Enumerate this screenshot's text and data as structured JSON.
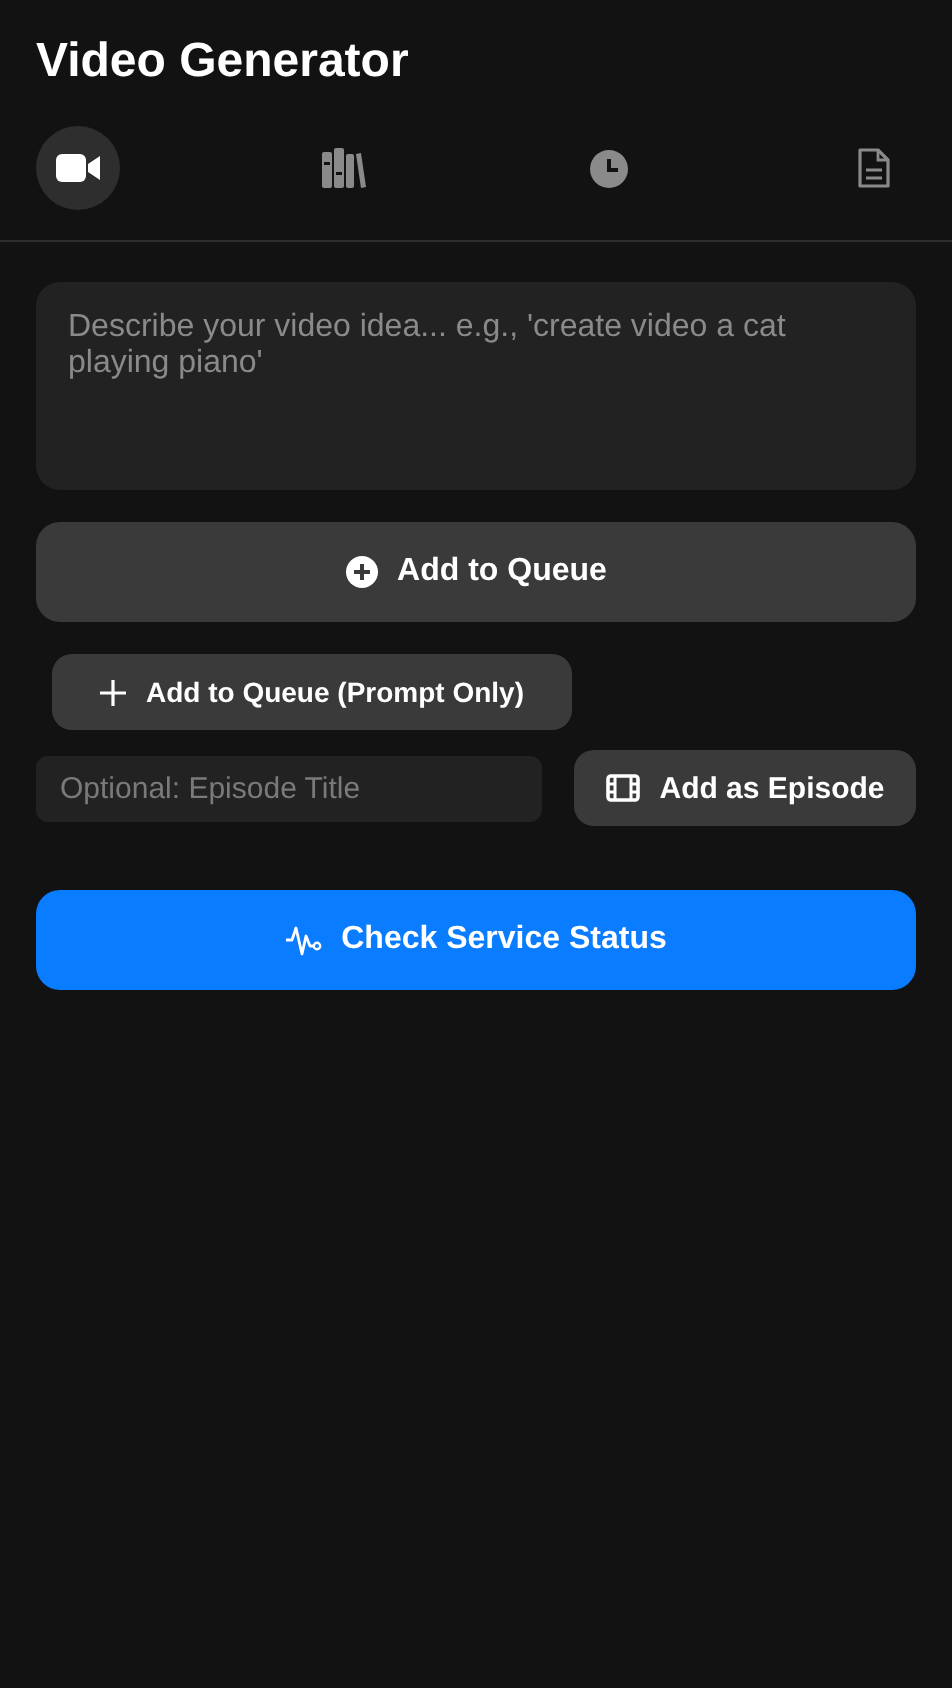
{
  "header": {
    "title": "Video Generator"
  },
  "tabs": [
    {
      "kind": "video",
      "selected": true
    },
    {
      "kind": "library",
      "selected": false
    },
    {
      "kind": "history",
      "selected": false
    },
    {
      "kind": "document",
      "selected": false
    }
  ],
  "prompt": {
    "placeholder": "Describe your video idea... e.g., 'create video a cat playing piano'"
  },
  "add_button": {
    "label": "Add to Queue"
  },
  "prompt_only_button": {
    "label": "Add to Queue (Prompt Only)"
  },
  "episode": {
    "placeholder": "Optional: Episode Title",
    "button": {
      "label": "Add as Episode"
    }
  },
  "status_button": {
    "label": "Check Service Status"
  }
}
